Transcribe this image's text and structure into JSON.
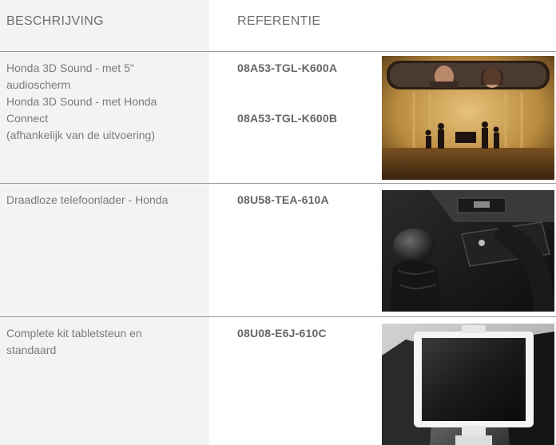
{
  "header": {
    "description": "BESCHRIJVING",
    "reference": "REFERENTIE"
  },
  "rows": [
    {
      "description_lines": [
        "Honda 3D Sound - met 5\"",
        "audioscherm",
        "Honda 3D Sound - met Honda",
        "Connect",
        "(afhankelijk van de uitvoering)"
      ],
      "refs": [
        "08A53-TGL-K600A",
        "08A53-TGL-K600B"
      ],
      "image": "concert-rearview-mirror-photo"
    },
    {
      "description_lines": [
        "Draadloze telefoonlader - Honda"
      ],
      "refs": [
        "08U58-TEA-610A"
      ],
      "image": "wireless-charger-console-photo"
    },
    {
      "description_lines": [
        "Complete kit tabletsteun en",
        "standaard"
      ],
      "refs": [
        "08U08-E6J-610C"
      ],
      "image": "tablet-headrest-holder-photo"
    }
  ]
}
